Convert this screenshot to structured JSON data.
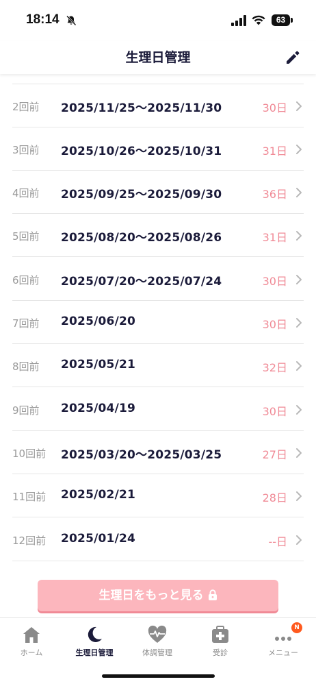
{
  "status": {
    "time": "18:14",
    "battery": "63"
  },
  "header": {
    "title": "生理日管理"
  },
  "periods": [
    {
      "cycle": "2回前",
      "dates": "2025/11/25〜2025/11/30",
      "days": "30",
      "unit": "日"
    },
    {
      "cycle": "3回前",
      "dates": "2025/10/26〜2025/10/31",
      "days": "31",
      "unit": "日"
    },
    {
      "cycle": "4回前",
      "dates": "2025/09/25〜2025/09/30",
      "days": "36",
      "unit": "日"
    },
    {
      "cycle": "5回前",
      "dates": "2025/08/20〜2025/08/26",
      "days": "31",
      "unit": "日"
    },
    {
      "cycle": "6回前",
      "dates": "2025/07/20〜2025/07/24",
      "days": "30",
      "unit": "日"
    },
    {
      "cycle": "7回前",
      "dates": "2025/06/20",
      "days": "30",
      "unit": "日"
    },
    {
      "cycle": "8回前",
      "dates": "2025/05/21",
      "days": "32",
      "unit": "日"
    },
    {
      "cycle": "9回前",
      "dates": "2025/04/19",
      "days": "30",
      "unit": "日"
    },
    {
      "cycle": "10回前",
      "dates": "2025/03/20〜2025/03/25",
      "days": "27",
      "unit": "日"
    },
    {
      "cycle": "11回前",
      "dates": "2025/02/21",
      "days": "28",
      "unit": "日"
    },
    {
      "cycle": "12回前",
      "dates": "2025/01/24",
      "days": "--",
      "unit": "日"
    }
  ],
  "more_button": {
    "label": "生理日をもっと見る"
  },
  "tabs": [
    {
      "label": "ホーム",
      "icon": "home-icon"
    },
    {
      "label": "生理日管理",
      "icon": "moon-icon",
      "active": true
    },
    {
      "label": "体調管理",
      "icon": "heart-pulse-icon"
    },
    {
      "label": "受診",
      "icon": "medical-box-icon"
    },
    {
      "label": "メニュー",
      "icon": "more-dots-icon",
      "badge": "N"
    }
  ],
  "colors": {
    "navy": "#1b1b3a",
    "pink": "#f08a96",
    "button": "#fcb6bd",
    "badge": "#ff5a1f"
  }
}
